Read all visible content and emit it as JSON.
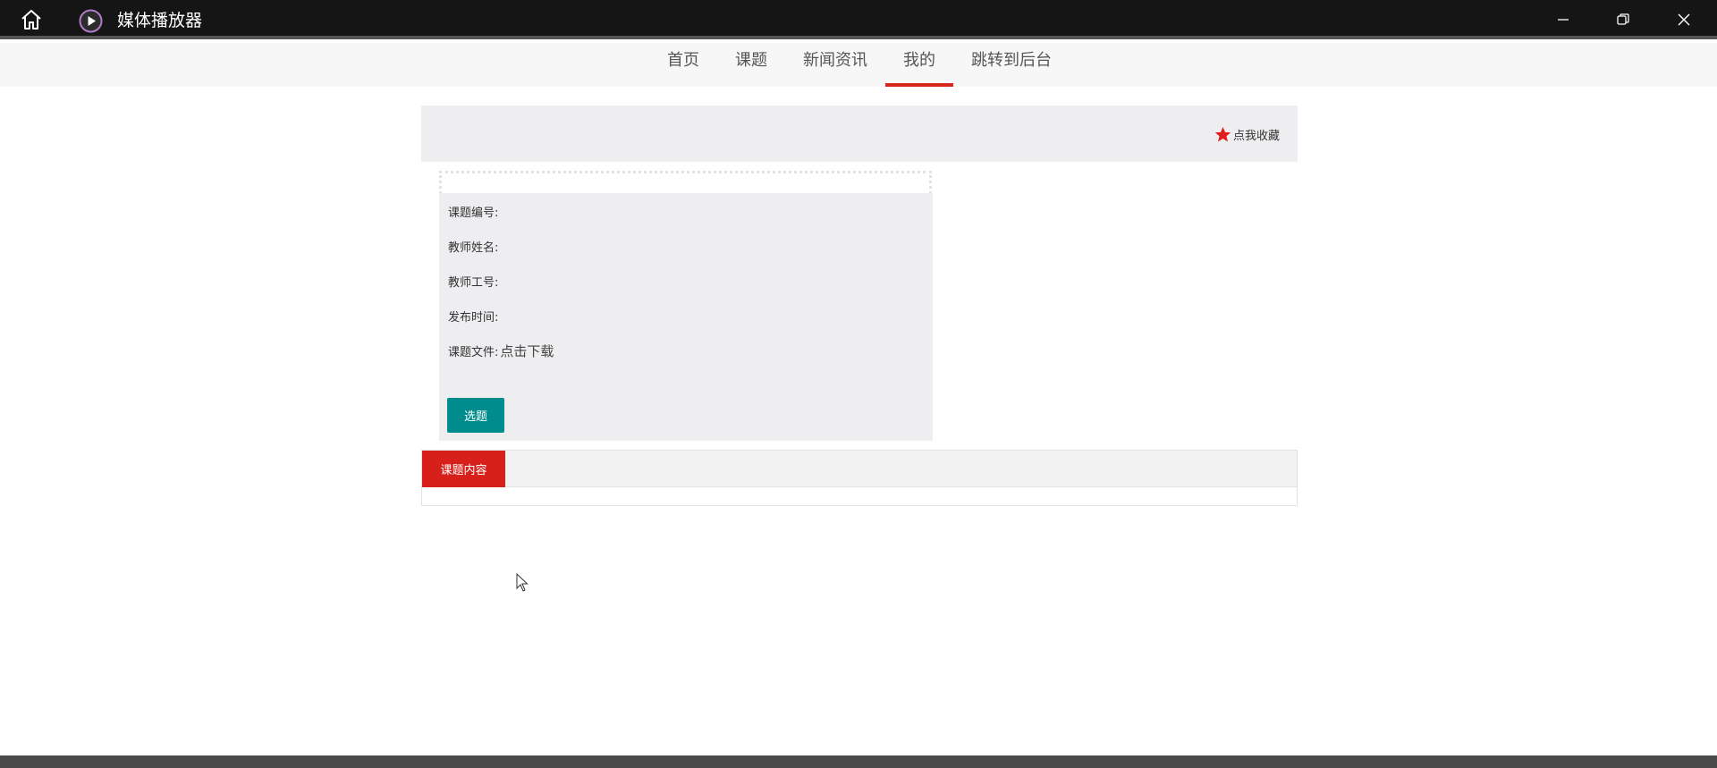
{
  "window": {
    "title": "媒体播放器",
    "icons": {
      "home": "home-icon",
      "app": "media-player-icon",
      "minimize": "minimize-icon",
      "maximize": "restore-icon",
      "close": "close-icon"
    }
  },
  "nav": {
    "items": [
      {
        "label": "首页"
      },
      {
        "label": "课题"
      },
      {
        "label": "新闻资讯"
      },
      {
        "label": "我的"
      },
      {
        "label": "跳转到后台"
      }
    ],
    "active_index": 3,
    "active_color": "#d8261c"
  },
  "favorite": {
    "label": "点我收藏",
    "icon": "star-icon",
    "icon_color": "#e21b1b"
  },
  "details": {
    "topic_no_label": "课题编号:",
    "topic_no_value": "",
    "teacher_name_label": "教师姓名:",
    "teacher_name_value": "",
    "teacher_id_label": "教师工号:",
    "teacher_id_value": "",
    "publish_time_label": "发布时间:",
    "publish_time_value": "",
    "file_label": "课题文件:",
    "file_link": "点击下载",
    "select_button": "选题",
    "select_button_color": "#008c8c"
  },
  "content": {
    "tab_label": "课题内容",
    "tab_color": "#d8201a"
  }
}
